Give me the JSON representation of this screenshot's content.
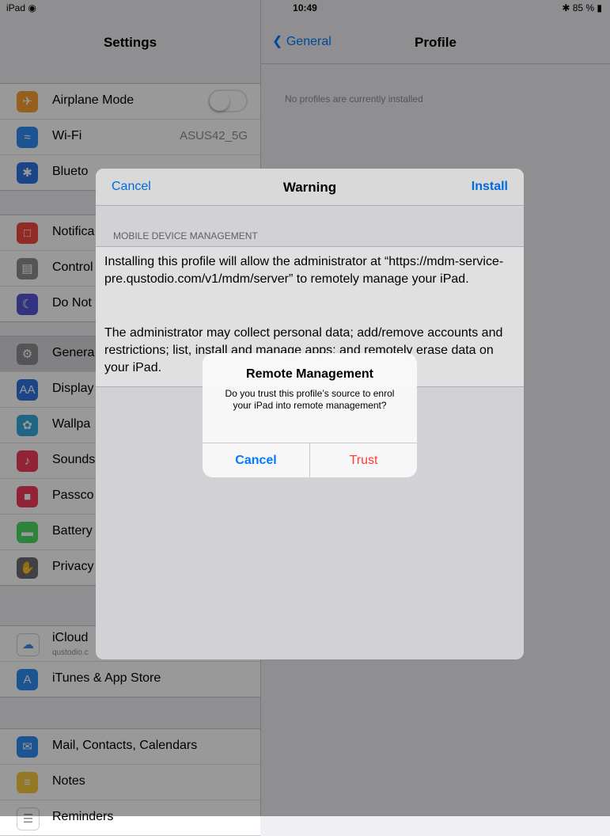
{
  "status": {
    "left": "iPad ◉",
    "time": "10:49",
    "battery": "✱ 85 % ▮"
  },
  "left_panel": {
    "title": "Settings",
    "group1": [
      {
        "label": "Airplane Mode",
        "icon": "airplane-icon",
        "color": "#f7a030",
        "glyph": "✈"
      },
      {
        "label": "Wi-Fi",
        "value": "ASUS42_5G",
        "icon": "wifi-icon",
        "color": "#2d8cf0",
        "glyph": "≈"
      },
      {
        "label": "Blueto",
        "icon": "bluetooth-icon",
        "color": "#2d74e0",
        "glyph": "✱"
      }
    ],
    "group2": [
      {
        "label": "Notifica",
        "icon": "notifications-icon",
        "color": "#f0483e",
        "glyph": "□"
      },
      {
        "label": "Control",
        "icon": "control-center-icon",
        "color": "#8e8e93",
        "glyph": "▤"
      },
      {
        "label": "Do Not",
        "icon": "do-not-disturb-icon",
        "color": "#5856d6",
        "glyph": "☾"
      }
    ],
    "group3": [
      {
        "label": "Genera",
        "icon": "gear-icon",
        "color": "#8e8e93",
        "glyph": "⚙",
        "selected": true
      },
      {
        "label": "Display",
        "icon": "display-icon",
        "color": "#2d74e0",
        "glyph": "AA"
      },
      {
        "label": "Wallpa",
        "icon": "wallpaper-icon",
        "color": "#35aadc",
        "glyph": "✿"
      },
      {
        "label": "Sounds",
        "icon": "sounds-icon",
        "color": "#f03c5a",
        "glyph": "♪"
      },
      {
        "label": "Passco",
        "icon": "lock-icon",
        "color": "#f03c5a",
        "glyph": "■"
      },
      {
        "label": "Battery",
        "icon": "battery-icon",
        "color": "#4cd964",
        "glyph": "▬"
      },
      {
        "label": "Privacy",
        "icon": "hand-icon",
        "color": "#6d6d72",
        "glyph": "✋"
      }
    ],
    "group4": [
      {
        "label": "iCloud",
        "sub": "qustodio.c",
        "icon": "cloud-icon",
        "color": "#ffffff",
        "glyph": "☁",
        "glyph_color": "#3a8ee6"
      },
      {
        "label": "iTunes & App Store",
        "icon": "app-store-icon",
        "color": "#2d8cf0",
        "glyph": "A"
      }
    ],
    "group5": [
      {
        "label": "Mail, Contacts, Calendars",
        "icon": "mail-icon",
        "color": "#2d8cf0",
        "glyph": "✉"
      },
      {
        "label": "Notes",
        "icon": "notes-icon",
        "color": "#f7c940",
        "glyph": "≡"
      },
      {
        "label": "Reminders",
        "icon": "reminders-icon",
        "color": "#ffffff",
        "glyph": "☰",
        "glyph_color": "#888888"
      }
    ]
  },
  "right_panel": {
    "back_label": "General",
    "title": "Profile",
    "empty_text": "No profiles are currently installed"
  },
  "sheet": {
    "cancel": "Cancel",
    "title": "Warning",
    "install": "Install",
    "section_label": "MOBILE DEVICE MANAGEMENT",
    "paragraph1": "Installing this profile will allow the administrator at “https://mdm-service-pre.qustodio.com/v1/mdm/server” to remotely manage your iPad.",
    "paragraph2": "The administrator may collect personal data; add/remove accounts and restrictions; list, install and manage apps; and remotely erase data on your iPad."
  },
  "alert": {
    "title": "Remote Management",
    "message": "Do you trust this profile’s source to enrol your iPad into remote management?",
    "cancel": "Cancel",
    "trust": "Trust"
  }
}
